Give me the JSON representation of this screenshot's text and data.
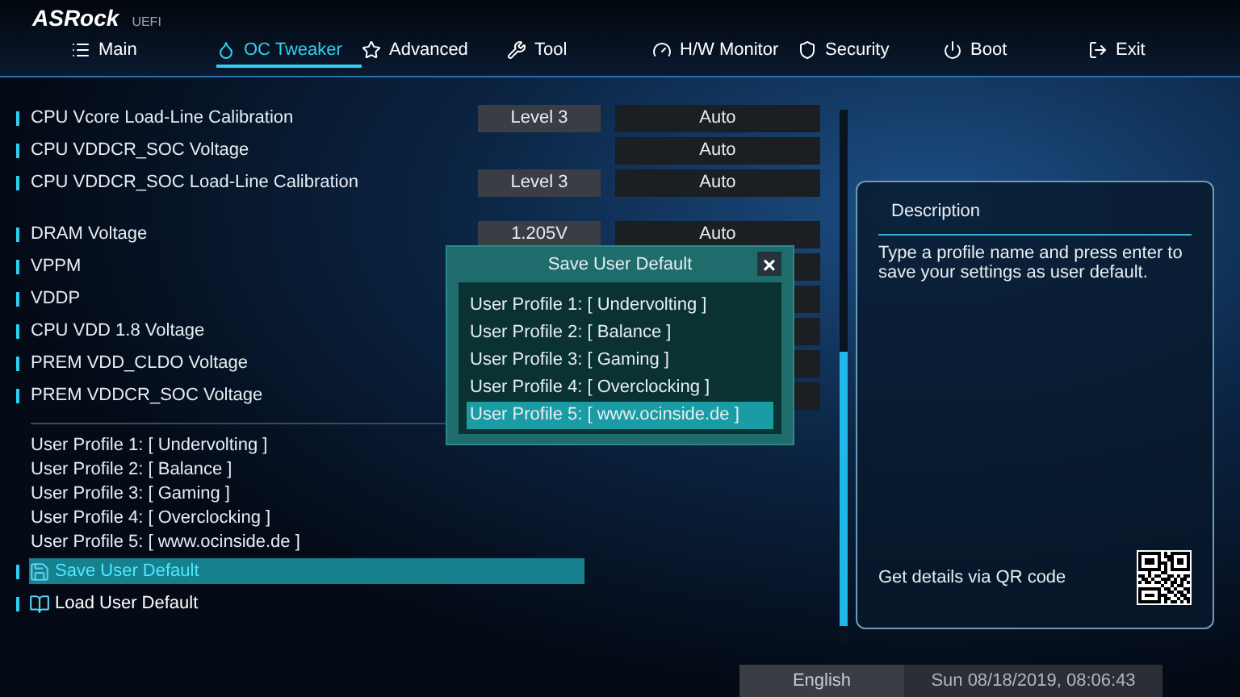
{
  "brand": {
    "logo": "ASRock",
    "subtitle": "UEFI"
  },
  "tabs": [
    {
      "label": "Main",
      "selected": false
    },
    {
      "label": "OC Tweaker",
      "selected": true
    },
    {
      "label": "Advanced",
      "selected": false
    },
    {
      "label": "Tool",
      "selected": false
    },
    {
      "label": "H/W Monitor",
      "selected": false
    },
    {
      "label": "Security",
      "selected": false
    },
    {
      "label": "Boot",
      "selected": false
    },
    {
      "label": "Exit",
      "selected": false
    }
  ],
  "setting_groups": [
    [
      {
        "label": "CPU Vcore Load-Line Calibration",
        "value": "Level 3",
        "auto": "Auto"
      },
      {
        "label": "CPU VDDCR_SOC Voltage",
        "auto": "Auto"
      },
      {
        "label": "CPU VDDCR_SOC Load-Line Calibration",
        "value": "Level 3",
        "auto": "Auto"
      }
    ],
    [
      {
        "label": "DRAM Voltage",
        "value": "1.205V",
        "auto": "Auto"
      },
      {
        "label": "VPPM"
      },
      {
        "label": "VDDP"
      },
      {
        "label": "CPU VDD 1.8 Voltage"
      },
      {
        "label": "PREM VDD_CLDO Voltage"
      },
      {
        "label": "PREM VDDCR_SOC Voltage"
      }
    ]
  ],
  "profiles": [
    "User Profile 1: [ Undervolting ]",
    "User Profile 2: [ Balance ]",
    "User Profile 3: [ Gaming ]",
    "User Profile 4: [ Overclocking ]",
    "User Profile 5: [ www.ocinside.de ]"
  ],
  "actions": [
    {
      "label": "Save User Default",
      "kind": "save",
      "selected": true
    },
    {
      "label": "Load User Default",
      "kind": "load",
      "selected": false
    }
  ],
  "dialog": {
    "title": "Save User Default",
    "close": "×",
    "items": [
      {
        "label": "User Profile 1: [ Undervolting ]",
        "selected": false
      },
      {
        "label": "User Profile 2: [ Balance ]",
        "selected": false
      },
      {
        "label": "User Profile 3: [ Gaming ]",
        "selected": false
      },
      {
        "label": "User Profile 4: [ Overclocking ]",
        "selected": false
      },
      {
        "label": "User Profile 5: [ www.ocinside.de ]",
        "selected": true
      }
    ]
  },
  "description": {
    "title": "Description",
    "text": "Type a profile name and press enter to save your settings as user default.",
    "qr_caption": "Get details via QR code"
  },
  "footer": {
    "language": "English",
    "datetime": "Sun 08/18/2019, 08:06:43"
  }
}
